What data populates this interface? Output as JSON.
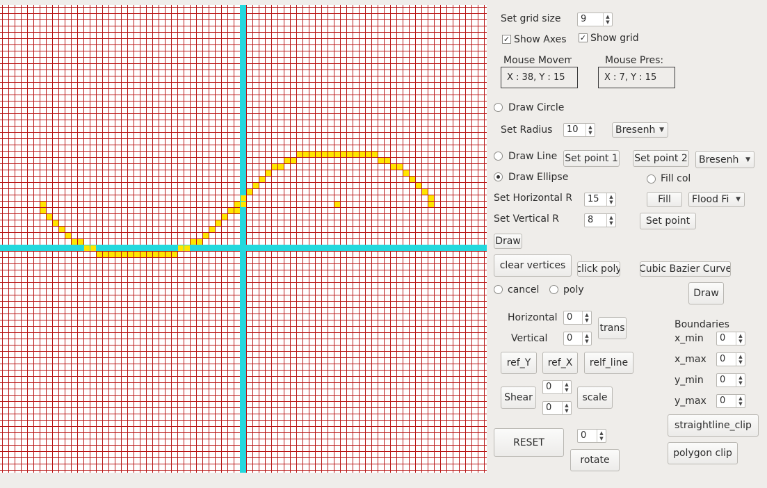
{
  "grid": {
    "grid_size": "9",
    "background_color": "#ffffff",
    "line_color": "#b81414",
    "axis_color": "#23d8dd",
    "plot_color": "#ffe600",
    "ellipse_center": [
      15,
      7
    ],
    "plotted_cells": [
      [
        15,
        7
      ],
      [
        30,
        7
      ],
      [
        30,
        8
      ],
      [
        29,
        9
      ],
      [
        28,
        10
      ],
      [
        27,
        11
      ],
      [
        26,
        12
      ],
      [
        25,
        13
      ],
      [
        24,
        13
      ],
      [
        23,
        14
      ],
      [
        22,
        14
      ],
      [
        21,
        15
      ],
      [
        20,
        15
      ],
      [
        19,
        15
      ],
      [
        18,
        15
      ],
      [
        17,
        15
      ],
      [
        16,
        15
      ],
      [
        15,
        15
      ],
      [
        14,
        15
      ],
      [
        13,
        15
      ],
      [
        12,
        15
      ],
      [
        11,
        15
      ],
      [
        10,
        15
      ],
      [
        9,
        15
      ],
      [
        8,
        14
      ],
      [
        7,
        14
      ],
      [
        6,
        13
      ],
      [
        5,
        13
      ],
      [
        4,
        12
      ],
      [
        3,
        11
      ],
      [
        2,
        10
      ],
      [
        1,
        9
      ],
      [
        0,
        8
      ],
      [
        0,
        7
      ],
      [
        -1,
        7
      ],
      [
        -1,
        6
      ],
      [
        -2,
        6
      ],
      [
        -3,
        5
      ],
      [
        -4,
        4
      ],
      [
        -5,
        3
      ],
      [
        -6,
        2
      ],
      [
        -7,
        1
      ],
      [
        -8,
        1
      ],
      [
        -9,
        0
      ],
      [
        -10,
        0
      ],
      [
        -11,
        -1
      ],
      [
        -12,
        -1
      ],
      [
        -13,
        -1
      ],
      [
        -14,
        -1
      ],
      [
        -15,
        -1
      ],
      [
        -16,
        -1
      ],
      [
        -17,
        -1
      ],
      [
        -18,
        -1
      ],
      [
        -19,
        -1
      ],
      [
        -20,
        -1
      ],
      [
        -21,
        -1
      ],
      [
        -22,
        -1
      ],
      [
        -23,
        -1
      ],
      [
        -24,
        0
      ],
      [
        -25,
        0
      ],
      [
        -26,
        1
      ],
      [
        -27,
        1
      ],
      [
        -28,
        2
      ],
      [
        -29,
        3
      ],
      [
        -30,
        4
      ],
      [
        -31,
        5
      ],
      [
        -32,
        6
      ],
      [
        -32,
        7
      ]
    ]
  },
  "controls": {
    "set_grid_size_label": "Set grid size",
    "grid_size_value": "9",
    "show_axes_label": "Show Axes",
    "show_grid_label": "Show grid",
    "show_axes_checked": "✓",
    "show_grid_checked": "✓",
    "mouse_movement_title": "Mouse Movem",
    "mouse_movement_value": "X : 38, Y : 15",
    "mouse_press_title": "Mouse Pres:",
    "mouse_press_value": "X : 7, Y : 15",
    "draw_circle_label": "Draw Circle",
    "set_radius_label": "Set Radius",
    "radius_value": "10",
    "circle_algo_value": "Bresenh",
    "draw_line_label": "Draw Line",
    "set_point1_label": "Set point 1",
    "set_point2_label": "Set point 2",
    "line_algo_value": "Bresenh",
    "draw_ellipse_label": "Draw Ellipse",
    "fill_color_label": "Fill col",
    "set_horizontal_r_label": "Set Horizontal R",
    "horizontal_r_value": "15",
    "fill_button_label": "Fill",
    "fill_algo_value": "Flood Fi",
    "set_vertical_r_label": "Set Vertical R",
    "vertical_r_value": "8",
    "set_point_label": "Set point",
    "draw_button_label": "Draw",
    "clear_vertices_label": "clear vertices",
    "click_poly_label": "click poly",
    "cubic_bezier_label": "Cubic Bazier Curve",
    "cancel_label": "cancel",
    "poly_label": "poly",
    "bezier_draw_label": "Draw",
    "horizontal_label": "Horizontal",
    "horizontal_value": "0",
    "vertical_label": "Vertical",
    "vertical_value": "0",
    "trans_label": "trans",
    "ref_y_label": "ref_Y",
    "ref_x_label": "ref_X",
    "relf_line_label": "relf_line",
    "shear_label": "Shear",
    "shear_x_value": "0",
    "shear_y_value": "0",
    "scale_label": "scale",
    "reset_label": "RESET",
    "rotate_value": "0",
    "rotate_label": "rotate",
    "boundaries_label": "Boundaries",
    "x_min_label": "x_min",
    "x_min_value": "0",
    "x_max_label": "x_max",
    "x_max_value": "0",
    "y_min_label": "y_min",
    "y_min_value": "0",
    "y_max_label": "y_max",
    "y_max_value": "0",
    "straightline_clip_label": "straightline_clip",
    "polygon_clip_label": "polygon clip"
  }
}
